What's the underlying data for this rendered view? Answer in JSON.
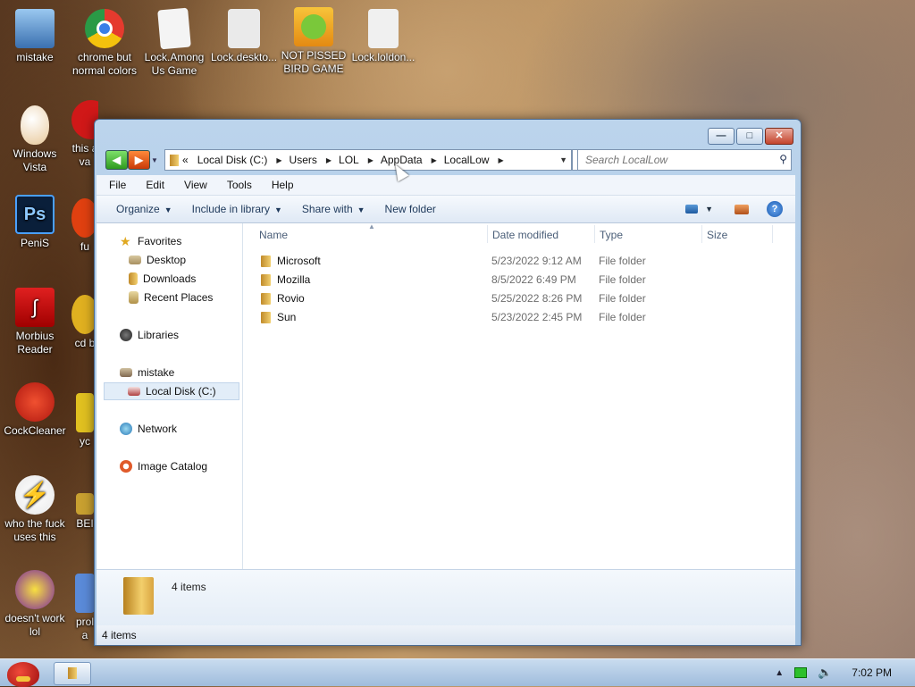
{
  "desktop": {
    "icons": [
      {
        "label": "mistake"
      },
      {
        "label": "chrome but normal colors"
      },
      {
        "label": "Lock.Among Us Game"
      },
      {
        "label": "Lock.deskto..."
      },
      {
        "label": "NOT PISSED BIRD GAME"
      },
      {
        "label": "Lock.loldon..."
      },
      {
        "label": "Windows Vista"
      },
      {
        "label": "this a va"
      },
      {
        "label": "PeniS"
      },
      {
        "label": "fu"
      },
      {
        "label": "Morbius Reader"
      },
      {
        "label": "cd b"
      },
      {
        "label": "CockCleaner"
      },
      {
        "label": "yc"
      },
      {
        "label": "who the fuck uses this"
      },
      {
        "label": "BEI"
      },
      {
        "label": "doesn't work lol"
      },
      {
        "label": "prol a"
      }
    ]
  },
  "window": {
    "address": {
      "overflow": "«",
      "crumbs": [
        "Local Disk (C:)",
        "Users",
        "LOL",
        "AppData",
        "LocalLow"
      ]
    },
    "search_placeholder": "Search LocalLow",
    "menu": [
      "File",
      "Edit",
      "View",
      "Tools",
      "Help"
    ],
    "commands": {
      "organize": "Organize",
      "include": "Include in library",
      "share": "Share with",
      "new_folder": "New folder"
    },
    "nav": {
      "favorites": "Favorites",
      "desktop": "Desktop",
      "downloads": "Downloads",
      "recent": "Recent Places",
      "libraries": "Libraries",
      "computer": "mistake",
      "local_disk": "Local Disk (C:)",
      "network": "Network",
      "image_catalog": "Image Catalog"
    },
    "columns": {
      "name": "Name",
      "date": "Date modified",
      "type": "Type",
      "size": "Size"
    },
    "files": [
      {
        "name": "Microsoft",
        "date": "5/23/2022 9:12 AM",
        "type": "File folder"
      },
      {
        "name": "Mozilla",
        "date": "8/5/2022 6:49 PM",
        "type": "File folder"
      },
      {
        "name": "Rovio",
        "date": "5/25/2022 8:26 PM",
        "type": "File folder"
      },
      {
        "name": "Sun",
        "date": "5/23/2022 2:45 PM",
        "type": "File folder"
      }
    ],
    "details_count": "4 items",
    "status": "4 items"
  },
  "taskbar": {
    "clock": "7:02 PM"
  },
  "colors": {
    "accent": "#2a6db8",
    "window_frame": "#bcd4ec",
    "close_button": "#c4442c"
  }
}
